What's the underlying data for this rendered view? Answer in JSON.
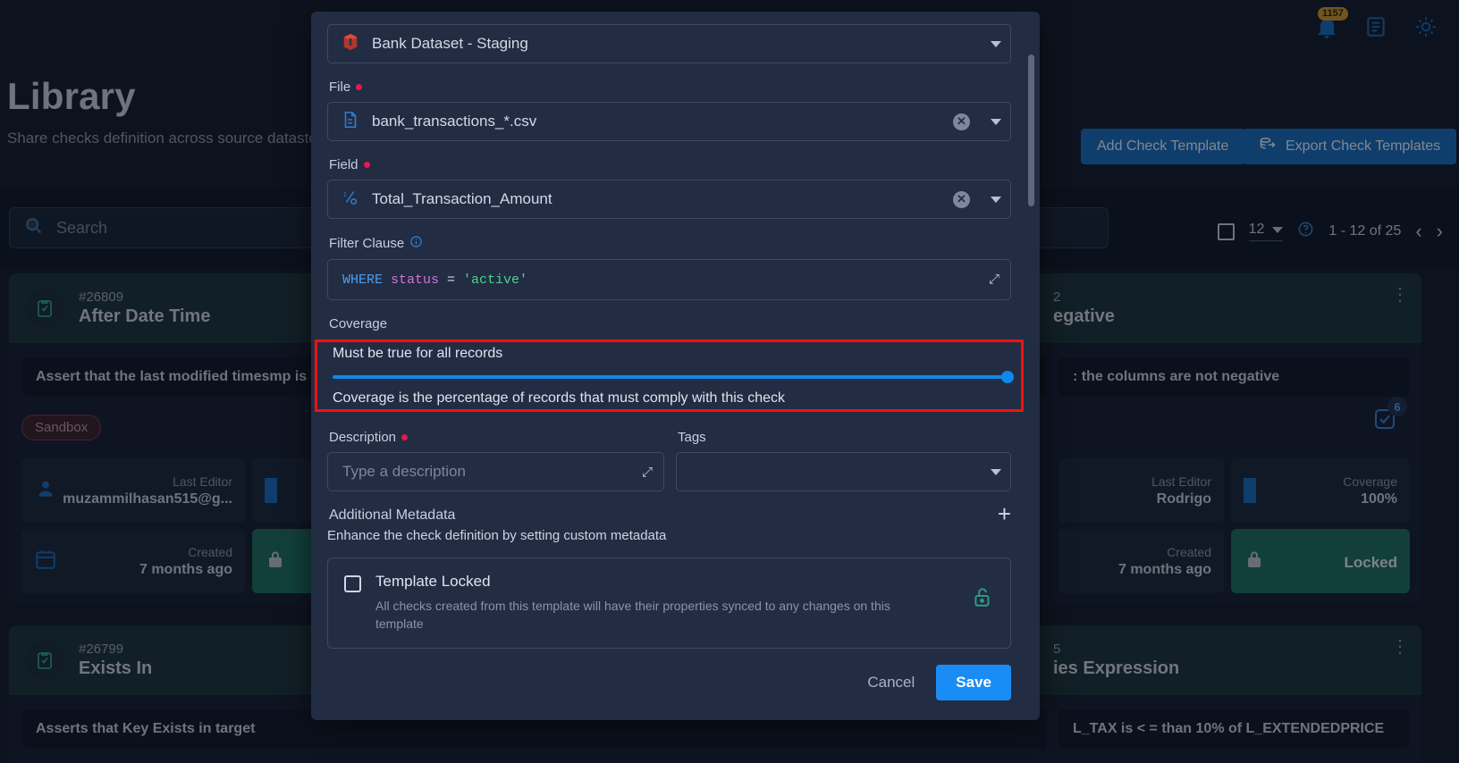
{
  "topbar": {
    "notifications_count": "1157",
    "icons": [
      "bell-icon",
      "document-icon",
      "brightness-icon"
    ]
  },
  "page": {
    "title": "Library",
    "subtitle": "Share checks definition across source datastores",
    "add_button": "Add Check Template",
    "export_button": "Export Check Templates"
  },
  "search": {
    "placeholder": "Search"
  },
  "pagination": {
    "page_size": "12",
    "range": "1 - 12 of 25",
    "prev": "‹",
    "next": "›"
  },
  "cards": [
    {
      "id": "#26809",
      "name": "After Date Time",
      "description": "Assert that the last modified timesmp is not",
      "tag": "Sandbox",
      "last_editor_label": "Last Editor",
      "last_editor": "muzammilhasan515@g...",
      "created_label": "Created",
      "created": "7 months ago"
    },
    {
      "id": "2",
      "name": "egative",
      "description": ": the columns are not negative",
      "badge_count": "6",
      "last_editor_label": "Last Editor",
      "last_editor": "Rodrigo",
      "coverage_label": "Coverage",
      "coverage": "100%",
      "created_label": "Created",
      "created": "7 months ago",
      "locked_label": "Locked"
    },
    {
      "id": "#26799",
      "name": "Exists In",
      "description": "Asserts that Key Exists in target"
    },
    {
      "id": "5",
      "name": "ies Expression",
      "description": "L_TAX is < = than 10% of L_EXTENDEDPRICE"
    }
  ],
  "modal": {
    "datastore": {
      "value": "Bank Dataset - Staging",
      "icon": "datastore-icon"
    },
    "file": {
      "label": "File",
      "required": true,
      "value": "bank_transactions_*.csv",
      "icon": "file-icon"
    },
    "field": {
      "label": "Field",
      "required": true,
      "value": "Total_Transaction_Amount",
      "icon": "field-icon"
    },
    "filter_clause": {
      "label": "Filter Clause",
      "info_icon": "info-icon",
      "sql": {
        "keyword": "WHERE",
        "column": "status",
        "operator": "=",
        "literal": "'active'"
      }
    },
    "coverage": {
      "label": "Coverage",
      "top_text": "Must be true for all records",
      "bottom_text": "Coverage is the percentage of records that must comply with this check",
      "slider_value": 100,
      "highlight_color": "#fb0f0f"
    },
    "description": {
      "label": "Description",
      "required": true,
      "placeholder": "Type a description",
      "value": ""
    },
    "tags": {
      "label": "Tags",
      "value": ""
    },
    "additional_metadata": {
      "label": "Additional Metadata",
      "hint": "Enhance the check definition by setting custom metadata",
      "add_icon": "plus-icon"
    },
    "template_locked": {
      "label": "Template Locked",
      "description": "All checks created from this template will have their properties synced to any changes on this template",
      "checked": false,
      "icon": "unlock-icon"
    },
    "footer": {
      "cancel": "Cancel",
      "save": "Save"
    }
  }
}
